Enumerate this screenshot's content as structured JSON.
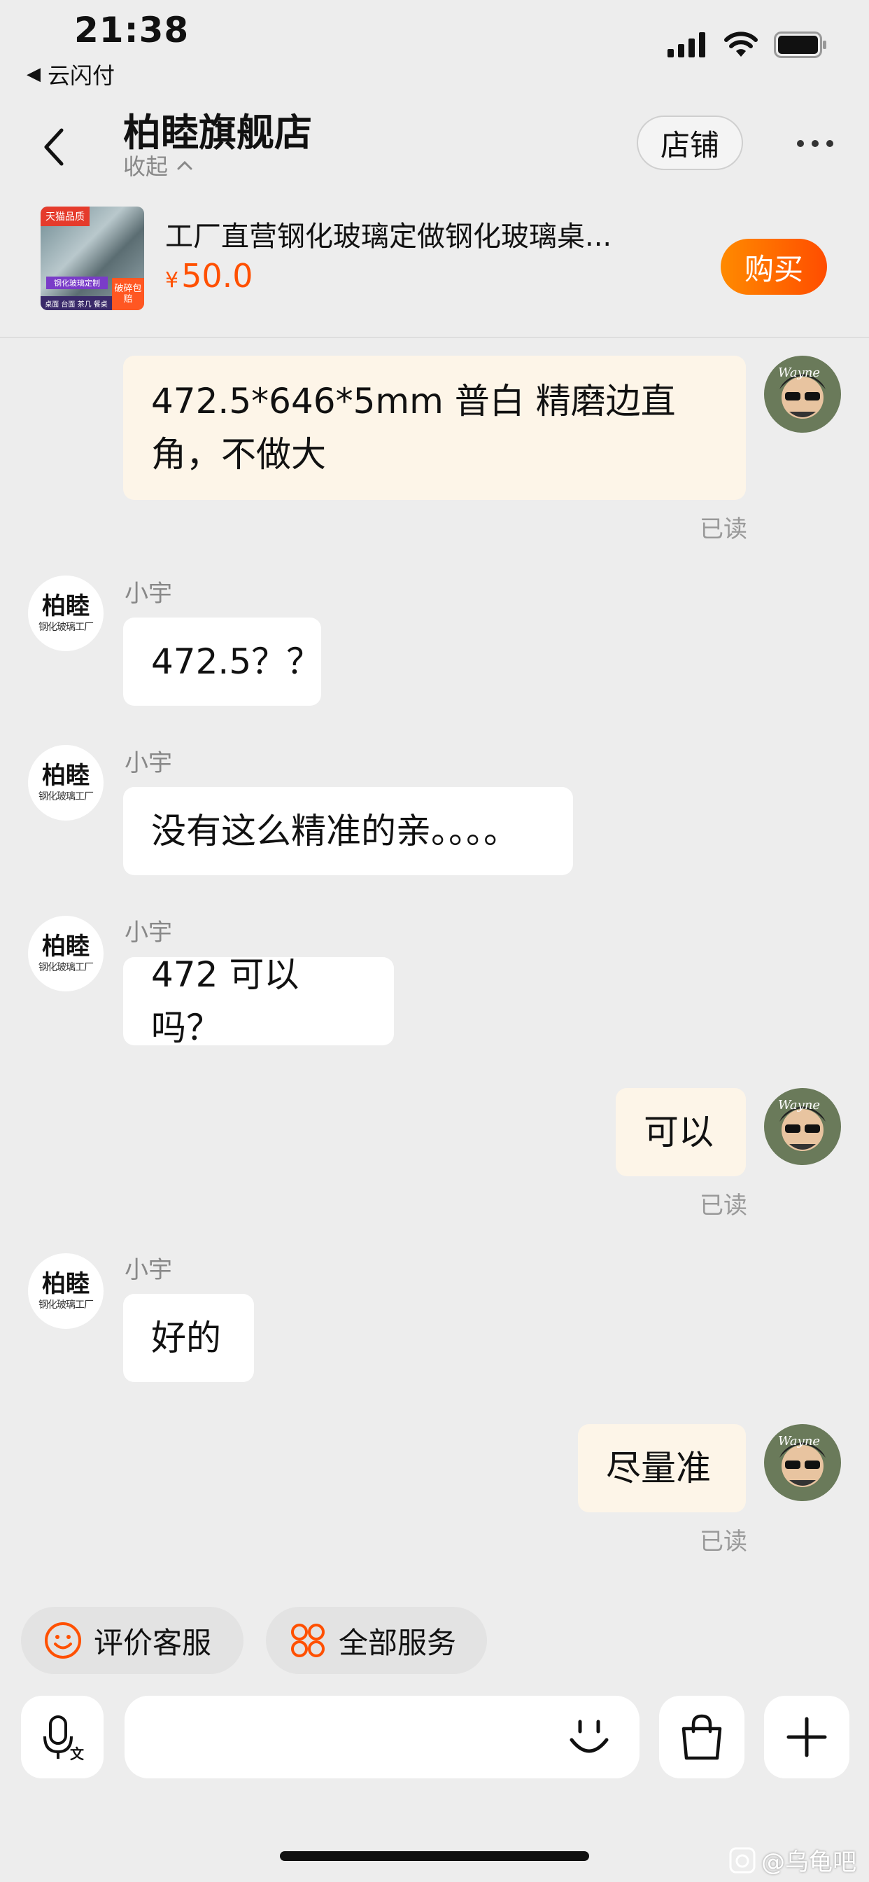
{
  "status_bar": {
    "time": "21:38",
    "back_app": "云闪付"
  },
  "header": {
    "shop_name": "柏睦旗舰店",
    "collapse_label": "收起",
    "store_button": "店铺"
  },
  "product": {
    "name": "工厂直营钢化玻璃定做钢化玻璃桌...",
    "currency": "¥",
    "price": "50.0",
    "buy_button": "购买",
    "img_badge_top": "天猫品质",
    "img_badge_mid": "钢化玻璃定制",
    "img_badge_corner": "破碎包赔",
    "img_strip": "桌面 台面 茶几 餐桌"
  },
  "shop_avatar": {
    "line1": "柏睦",
    "line2": "钢化玻璃工厂"
  },
  "messages": [
    {
      "side": "out",
      "text_line1": "472.5*646*5mm  普白  精磨边直",
      "text_line2": "角，不做大",
      "read": "已读"
    },
    {
      "side": "in",
      "sender": "小宇",
      "text": "472.5？？"
    },
    {
      "side": "in",
      "sender": "小宇",
      "text": "没有这么精准的亲。。。。"
    },
    {
      "side": "in",
      "sender": "小宇",
      "text": "472  可以吗？"
    },
    {
      "side": "out",
      "text": "可以",
      "read": "已读"
    },
    {
      "side": "in",
      "sender": "小宇",
      "text": "好的"
    },
    {
      "side": "out",
      "text": "尽量准",
      "read": "已读"
    }
  ],
  "quick_actions": [
    {
      "label": "评价客服",
      "icon": "smiley-icon"
    },
    {
      "label": "全部服务",
      "icon": "grid-icon"
    }
  ],
  "watermark": "@乌龟吧",
  "colors": {
    "accent": "#ff5000",
    "background": "#ededed",
    "out_bubble": "#fdf5e8",
    "in_bubble": "#ffffff"
  }
}
